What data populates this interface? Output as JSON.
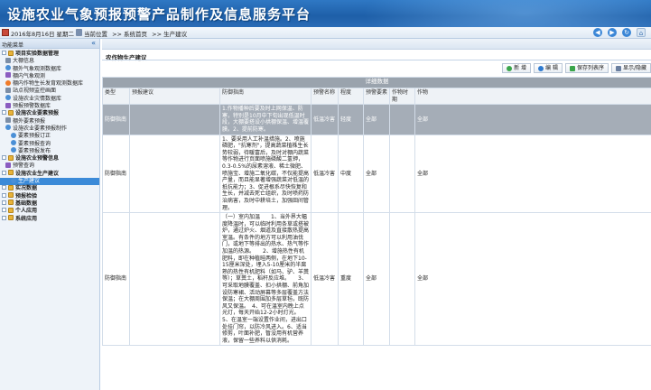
{
  "app": {
    "title": "设施农业气象预报预警产品制作及信息服务平台"
  },
  "topbar": {
    "date": "2016年8月16日  星期二",
    "breadcrumb": [
      "当前位置",
      ">> 系统首页",
      ">> 生产建议"
    ]
  },
  "sidebar": {
    "header": "功能菜单",
    "collapse": "«",
    "items": [
      {
        "label": "项目实验数据管理",
        "level": 1,
        "expanded": true
      },
      {
        "label": "大棚信息",
        "level": 2
      },
      {
        "label": "棚外气象观测数据库",
        "level": 2
      },
      {
        "label": "棚内气象观测",
        "level": 2
      },
      {
        "label": "棚内作物生长发育观测数据库",
        "level": 2
      },
      {
        "label": "站点视频监控画面",
        "level": 2
      },
      {
        "label": "设施农业灾情数据库",
        "level": 2
      },
      {
        "label": "预报预警数据库",
        "level": 2
      },
      {
        "label": "设施农业要素预报",
        "level": 1,
        "expanded": true
      },
      {
        "label": "棚外要素预报",
        "level": 2
      },
      {
        "label": "设施农业要素预报制作",
        "level": 2
      },
      {
        "label": "要素预报订正",
        "level": 3
      },
      {
        "label": "要素预报查询",
        "level": 3
      },
      {
        "label": "要素预报发布",
        "level": 3
      },
      {
        "label": "设施农业预警信息",
        "level": 1,
        "expanded": true
      },
      {
        "label": "预警查询",
        "level": 2
      },
      {
        "label": "设施农业生产建议",
        "level": 1,
        "expanded": true
      },
      {
        "label": "生产建议",
        "level": 3,
        "selected": true
      },
      {
        "label": "实况数据",
        "level": 1
      },
      {
        "label": "预报检验",
        "level": 1
      },
      {
        "label": "基础数据",
        "level": 1
      },
      {
        "label": "个人应用",
        "level": 1
      },
      {
        "label": "系统应用",
        "level": 1
      }
    ]
  },
  "main": {
    "panel_title": "农作物生产建议",
    "actions": {
      "add": "新 增",
      "edit": "编 辑",
      "save_cols": "保存列表序",
      "show_cols": "显示/隐藏"
    },
    "table": {
      "caption": "详细数据",
      "headers": [
        "类型",
        "预报建议",
        "防御指南",
        "预警名称",
        "程度",
        "预警要素",
        "作物时期",
        "作物"
      ],
      "rows": [
        {
          "type": "防御指南",
          "advice": "",
          "guide": "1.作物播种后要及时上网保温、防寒，特别是10月中下旬出现低温时段，大棚要搭设小拱棚保温、增温覆膜。2、提前防寒。",
          "warning": "低温冷害",
          "degree": "轻度",
          "element": "全部",
          "period": "",
          "crop": "全部"
        },
        {
          "type": "防御指南",
          "advice": "",
          "guide": "1、要采用人工补温措施。2、喷施磷肥，\"抗寒剂\"，提高蔬菜植株生长势较弱，待暖富后，及时对棚内蔬菜等作物进行页面喷施磷酸二氢钾，0.3-0.5%的尿素溶液、稀土微肥、喷施宝、增施二氧化碳，不仅能提高产量，而且能显著增强蔬菜对低温的抵抗能力；3、促进根系尽快恢复和生长，并减去死亡组织，及时喷药防治病害，及时中耕培土，加强田间管理。",
          "warning": "低温冷害",
          "degree": "中度",
          "element": "全部",
          "period": "",
          "crop": "全部"
        },
        {
          "type": "防御指南",
          "advice": "",
          "guide": "（一）室内加温　　1、当外界大幅度降温时，可以临时利用条草或搭被炉，通过炉火、烟道及直接散热提高室温。有条件的地方可以利用油伐门，或地下等排出的热水、热气等作加温的热源。　　2、增施热性有机肥料，即在种植畦两侧，在地下10-15厘米深处，埋入5-10厘米的半腐熟的热性有机肥料（如马、驴、羊粪等）；草粪土，稻秆反应堆。　　3、可采取地膜覆盖、扣小拱棚、前角加设防寒裙、活动屏幕等多层覆盖方法保温；在大棚周围加多层草毡，既防风又保温。　4、可在温室内晚上点光灯，每天开始12-2小时灯光。　5、在温室一端设置作业间，进出口处挂门帘，以防冷风进入。6、适当修剪，叶面补肥，暂没用有机营养液，保留一些养料以供消耗。",
          "warning": "低温冷害",
          "degree": "重度",
          "element": "全部",
          "period": "",
          "crop": "全部"
        }
      ]
    }
  }
}
